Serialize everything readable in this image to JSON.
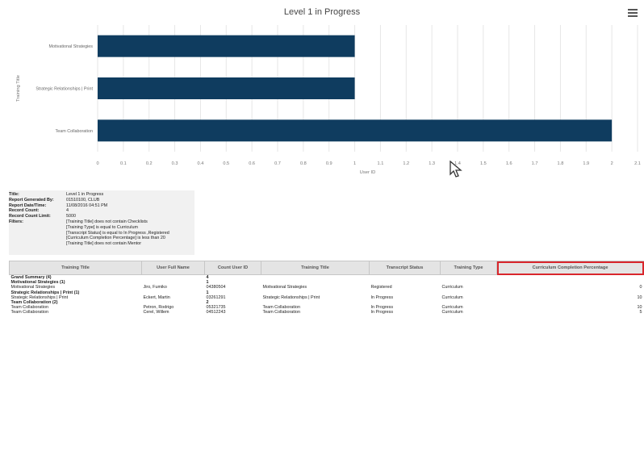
{
  "chart_title": "Level 1 in Progress",
  "chart_data": {
    "type": "bar",
    "orientation": "horizontal",
    "categories": [
      "Motivational Strategies",
      "Strategic Relationships | Print",
      "Team Collaboration"
    ],
    "values": [
      1,
      1,
      2
    ],
    "xlabel": "User ID",
    "ylabel": "Training Title",
    "xlim": [
      0,
      2.1
    ],
    "xticks": [
      "0",
      "0.1",
      "0.2",
      "0.3",
      "0.4",
      "0.5",
      "0.6",
      "0.7",
      "0.8",
      "0.9",
      "1",
      "1.1",
      "1.2",
      "1.3",
      "1.4",
      "1.5",
      "1.6",
      "1.7",
      "1.8",
      "1.9",
      "2",
      "2.1"
    ],
    "bar_color": "#0f3c5f",
    "grid": true
  },
  "report_info": [
    {
      "label": "Title:",
      "value": "Level 1 in Progress"
    },
    {
      "label": "Report Generated By:",
      "value": "01510100, CLUB"
    },
    {
      "label": "Report Date/Time:",
      "value": "11/08/2016 04:51 PM"
    },
    {
      "label": "Record Count:",
      "value": "4"
    },
    {
      "label": "Record Count Limit:",
      "value": "5000"
    },
    {
      "label": "Filters:",
      "value": "[Training Title] does not contain Checklists"
    },
    {
      "label": "",
      "value": "[Training Type] is equal to Curriculum"
    },
    {
      "label": "",
      "value": "[Transcript Status] is equal to In Progress ,Registered"
    },
    {
      "label": "",
      "value": "[Curriculum Completion Percentage] is less than 20"
    },
    {
      "label": "",
      "value": "[Training Title] does not contain Mentor"
    }
  ],
  "table": {
    "headers": [
      "Training Title",
      "User Full Name",
      "Count User ID",
      "Training Title",
      "Transcript Status",
      "Training Type",
      "Curriculum Completion Percentage"
    ],
    "highlight_header": 6,
    "rows": [
      {
        "bold": true,
        "cells": [
          "Grand Summary (4)",
          "",
          "4",
          "",
          "",
          "",
          ""
        ]
      },
      {
        "bold": true,
        "cells": [
          "Motivational Strategies (1)",
          "",
          "1",
          "",
          "",
          "",
          ""
        ]
      },
      {
        "bold": false,
        "cells": [
          "Motivational Strategies",
          "Jiro, Fumiko",
          "04380504",
          "Motivational Strategies",
          "Registered",
          "Curriculum",
          "0"
        ]
      },
      {
        "bold": true,
        "cells": [
          "Strategic Relationships | Print (1)",
          "",
          "1",
          "",
          "",
          "",
          ""
        ]
      },
      {
        "bold": false,
        "cells": [
          "Strategic Relationships | Print",
          "Eckert, Martin",
          "03261291",
          "Strategic Relationships | Print",
          "In Progress",
          "Curriculum",
          "10"
        ]
      },
      {
        "bold": true,
        "cells": [
          "Team Collaboration (2)",
          "",
          "2",
          "",
          "",
          "",
          ""
        ]
      },
      {
        "bold": false,
        "cells": [
          "Team Collaboration",
          "Petron, Rodrigo",
          "05321735",
          "Team Collaboration",
          "In Progress",
          "Curriculum",
          "10"
        ]
      },
      {
        "bold": false,
        "cells": [
          "Team Collaboration",
          "Cerel, Willem",
          "04512243",
          "Team Collaboration",
          "In Progress",
          "Curriculum",
          "5"
        ]
      }
    ]
  }
}
